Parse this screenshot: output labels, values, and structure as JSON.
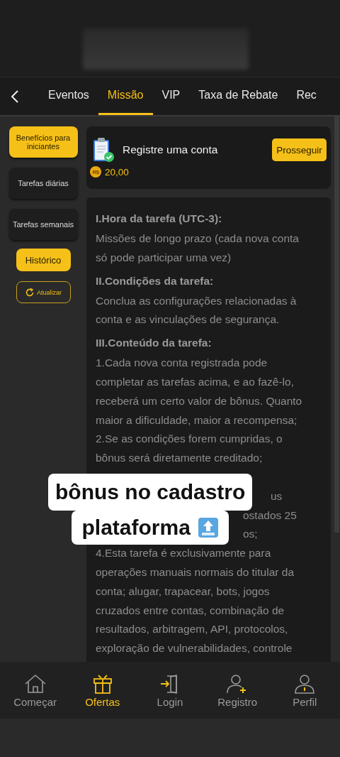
{
  "tabs": [
    {
      "label": "Eventos",
      "selected": false
    },
    {
      "label": "Missão",
      "selected": true
    },
    {
      "label": "VIP",
      "selected": false
    },
    {
      "label": "Taxa de Rebate",
      "selected": false
    },
    {
      "label": "Rec",
      "selected": false
    }
  ],
  "sidebar": {
    "items": [
      {
        "label": "Benefícios para iniciantes",
        "selected": true
      },
      {
        "label": "Tarefas diárias",
        "selected": false
      },
      {
        "label": "Tarefas semanais",
        "selected": false
      }
    ],
    "history_button": "Histórico",
    "refresh_button": "Atualizar"
  },
  "task": {
    "title": "Registre uma conta",
    "button": "Prosseguir",
    "currency": "R$",
    "reward": "20,00"
  },
  "rules": [
    {
      "kind": "heading",
      "text": "I.Hora da tarefa (UTC-3):"
    },
    {
      "kind": "text",
      "text": "Missões de longo prazo (cada nova conta"
    },
    {
      "kind": "text",
      "text": "só pode participar uma vez)"
    },
    {
      "kind": "heading",
      "text": "II.Condições da tarefa:"
    },
    {
      "kind": "text",
      "text": "Conclua as configurações relacionadas à"
    },
    {
      "kind": "text",
      "text": "conta e as vinculações de segurança."
    },
    {
      "kind": "heading",
      "text": "III.Conteúdo da tarefa:"
    },
    {
      "kind": "text",
      "text": "1.Cada nova conta registrada pode"
    },
    {
      "kind": "text",
      "text": "completar as tarefas acima, e ao fazê-lo,"
    },
    {
      "kind": "text",
      "text": "receberá um certo valor de bônus. Quanto"
    },
    {
      "kind": "text",
      "text": "maior a dificuldade, maior a recompensa;"
    },
    {
      "kind": "text",
      "text": "2.Se as condições forem cumpridas, o"
    },
    {
      "kind": "text",
      "text": "bônus será diretamente creditado;"
    },
    {
      "kind": "fragment",
      "text": "us"
    },
    {
      "kind": "fragment",
      "text": "ostados 25"
    },
    {
      "kind": "fragment",
      "text": "os;"
    },
    {
      "kind": "text",
      "text": "4.Esta tarefa é exclusivamente para"
    },
    {
      "kind": "text",
      "text": "operações manuais normais do titular da"
    },
    {
      "kind": "text",
      "text": "conta; alugar, trapacear, bots, jogos"
    },
    {
      "kind": "text",
      "text": "cruzados entre contas, combinação de"
    },
    {
      "kind": "text",
      "text": "resultados, arbitragem, API, protocolos,"
    },
    {
      "kind": "text",
      "text": "exploração de vulnerabilidades, controle"
    }
  ],
  "caption": [
    "bônus no cadastro",
    "plataforma"
  ],
  "bottom_nav": [
    {
      "kind": "home",
      "label": "Começar",
      "selected": false
    },
    {
      "kind": "gift",
      "label": "Ofertas",
      "selected": true
    },
    {
      "kind": "login",
      "label": "Login",
      "selected": false
    },
    {
      "kind": "register",
      "label": "Registro",
      "selected": false
    },
    {
      "kind": "profile",
      "label": "Perfil",
      "selected": false
    }
  ]
}
